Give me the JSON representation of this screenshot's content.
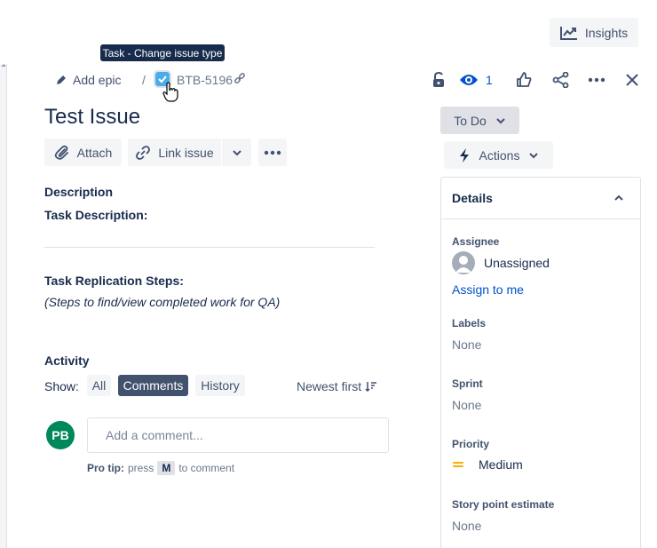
{
  "header": {
    "insights_label": "Insights",
    "tooltip": "Task - Change issue type",
    "add_epic_label": "Add epic",
    "breadcrumb_separator": "/",
    "issue_key": "BTB-5196",
    "watchers_count": "1"
  },
  "issue": {
    "title": "Test Issue",
    "attach_label": "Attach",
    "link_issue_label": "Link issue"
  },
  "description": {
    "heading": "Description",
    "task_description_label": "Task Description:",
    "replication_steps_label": "Task Replication Steps:",
    "replication_steps_text": "(Steps to find/view completed work for QA)"
  },
  "activity": {
    "heading": "Activity",
    "show_label": "Show:",
    "filters": [
      "All",
      "Comments",
      "History"
    ],
    "selected_filter": "Comments",
    "sort_label": "Newest first",
    "user_initials": "PB",
    "comment_placeholder": "Add a comment...",
    "pro_tip_label": "Pro tip:",
    "pro_tip_press": "press",
    "pro_tip_key": "M",
    "pro_tip_suffix": "to comment"
  },
  "sidebar": {
    "status_label": "To Do",
    "actions_label": "Actions",
    "details_title": "Details",
    "assignee_label": "Assignee",
    "assignee_value": "Unassigned",
    "assign_to_me": "Assign to me",
    "labels_label": "Labels",
    "labels_value": "None",
    "sprint_label": "Sprint",
    "sprint_value": "None",
    "priority_label": "Priority",
    "priority_value": "Medium",
    "story_points_label": "Story point estimate",
    "story_points_value": "None"
  },
  "colors": {
    "accent": "#0052cc",
    "task_icon": "#4bade8",
    "avatar_pb": "#00875a",
    "priority_medium": "#ffab00",
    "selected_filter_bg": "#42526e"
  }
}
